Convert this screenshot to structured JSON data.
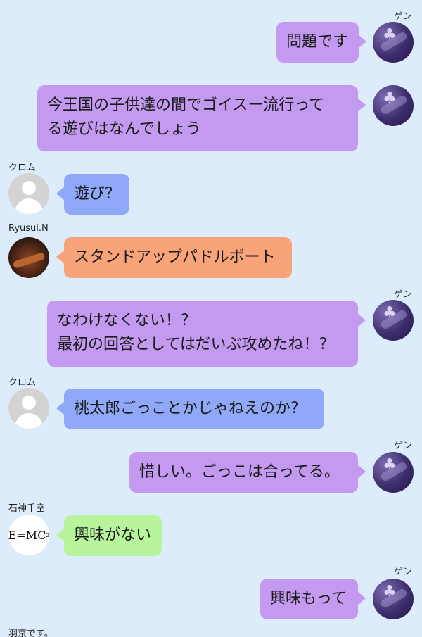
{
  "colors": {
    "background": "#dcecfb",
    "bubble_purple": "#c49af0",
    "bubble_blue": "#8fa8f7",
    "bubble_orange": "#f8a379",
    "bubble_green": "#b7f49b"
  },
  "messages": [
    {
      "sender": "ゲン",
      "side": "right",
      "avatar": "purple-clover-avatar",
      "lines": [
        "問題です"
      ]
    },
    {
      "sender": "",
      "side": "right",
      "avatar": "purple-clover-avatar",
      "lines": [
        "今王国の子供達の間でゴイスー流行って",
        "る遊びはなんでしょう"
      ]
    },
    {
      "sender": "クロム",
      "side": "left",
      "avatar": "default-user-avatar",
      "lines": [
        "遊び？"
      ]
    },
    {
      "sender": "Ryusui.N",
      "side": "left",
      "avatar": "ship-photo-avatar",
      "lines": [
        "スタンドアップパドルボート"
      ]
    },
    {
      "sender": "ゲン",
      "side": "right",
      "avatar": "purple-clover-avatar",
      "lines": [
        "なわけなくない！？",
        "最初の回答としてはだいぶ攻めたね！？"
      ]
    },
    {
      "sender": "クロム",
      "side": "left",
      "avatar": "default-user-avatar",
      "lines": [
        "桃太郎ごっことかじゃねえのか？"
      ]
    },
    {
      "sender": "ゲン",
      "side": "right",
      "avatar": "purple-clover-avatar",
      "lines": [
        "惜しい。ごっこは合ってる。"
      ]
    },
    {
      "sender": "石神千空",
      "side": "left",
      "avatar": "emc-avatar",
      "avatar_text": "E=MC",
      "avatar_sup": "2",
      "lines": [
        "興味がない"
      ]
    },
    {
      "sender": "ゲン",
      "side": "right",
      "avatar": "purple-clover-avatar",
      "lines": [
        "興味もって"
      ]
    },
    {
      "sender": "羽京です。",
      "side": "left",
      "lines": []
    }
  ]
}
